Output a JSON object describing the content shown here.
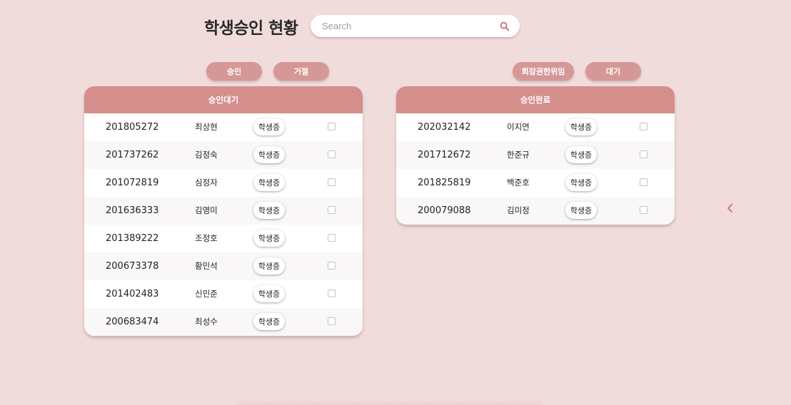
{
  "header": {
    "title": "학생승인 현황",
    "search_placeholder": "Search",
    "search_value": ""
  },
  "buttons": {
    "approve": "승인",
    "reject": "거절",
    "delegate": "회장권한위임",
    "wait": "대기"
  },
  "pending": {
    "title": "승인대기",
    "rows": [
      {
        "id": "201805272",
        "name": "최상현",
        "card": "학생증"
      },
      {
        "id": "201737262",
        "name": "김정숙",
        "card": "학생증"
      },
      {
        "id": "201072819",
        "name": "심정자",
        "card": "학생증"
      },
      {
        "id": "201636333",
        "name": "김영미",
        "card": "학생증"
      },
      {
        "id": "201389222",
        "name": "조정호",
        "card": "학생증"
      },
      {
        "id": "200673378",
        "name": "황민석",
        "card": "학생증"
      },
      {
        "id": "201402483",
        "name": "신민준",
        "card": "학생증"
      },
      {
        "id": "200683474",
        "name": "최성수",
        "card": "학생증"
      }
    ]
  },
  "approved": {
    "title": "승인완료",
    "rows": [
      {
        "id": "202032142",
        "name": "이지연",
        "card": "학생증"
      },
      {
        "id": "201712672",
        "name": "한준규",
        "card": "학생증"
      },
      {
        "id": "201825819",
        "name": "백준호",
        "card": "학생증"
      },
      {
        "id": "200079088",
        "name": "김미정",
        "card": "학생증"
      }
    ]
  },
  "icons": {
    "search": "search-icon",
    "back": "chevron-left-icon"
  },
  "colors": {
    "background": "#f1dcdc",
    "accent": "#d48f8c",
    "button": "#d59896",
    "icon": "#d07b7b"
  }
}
